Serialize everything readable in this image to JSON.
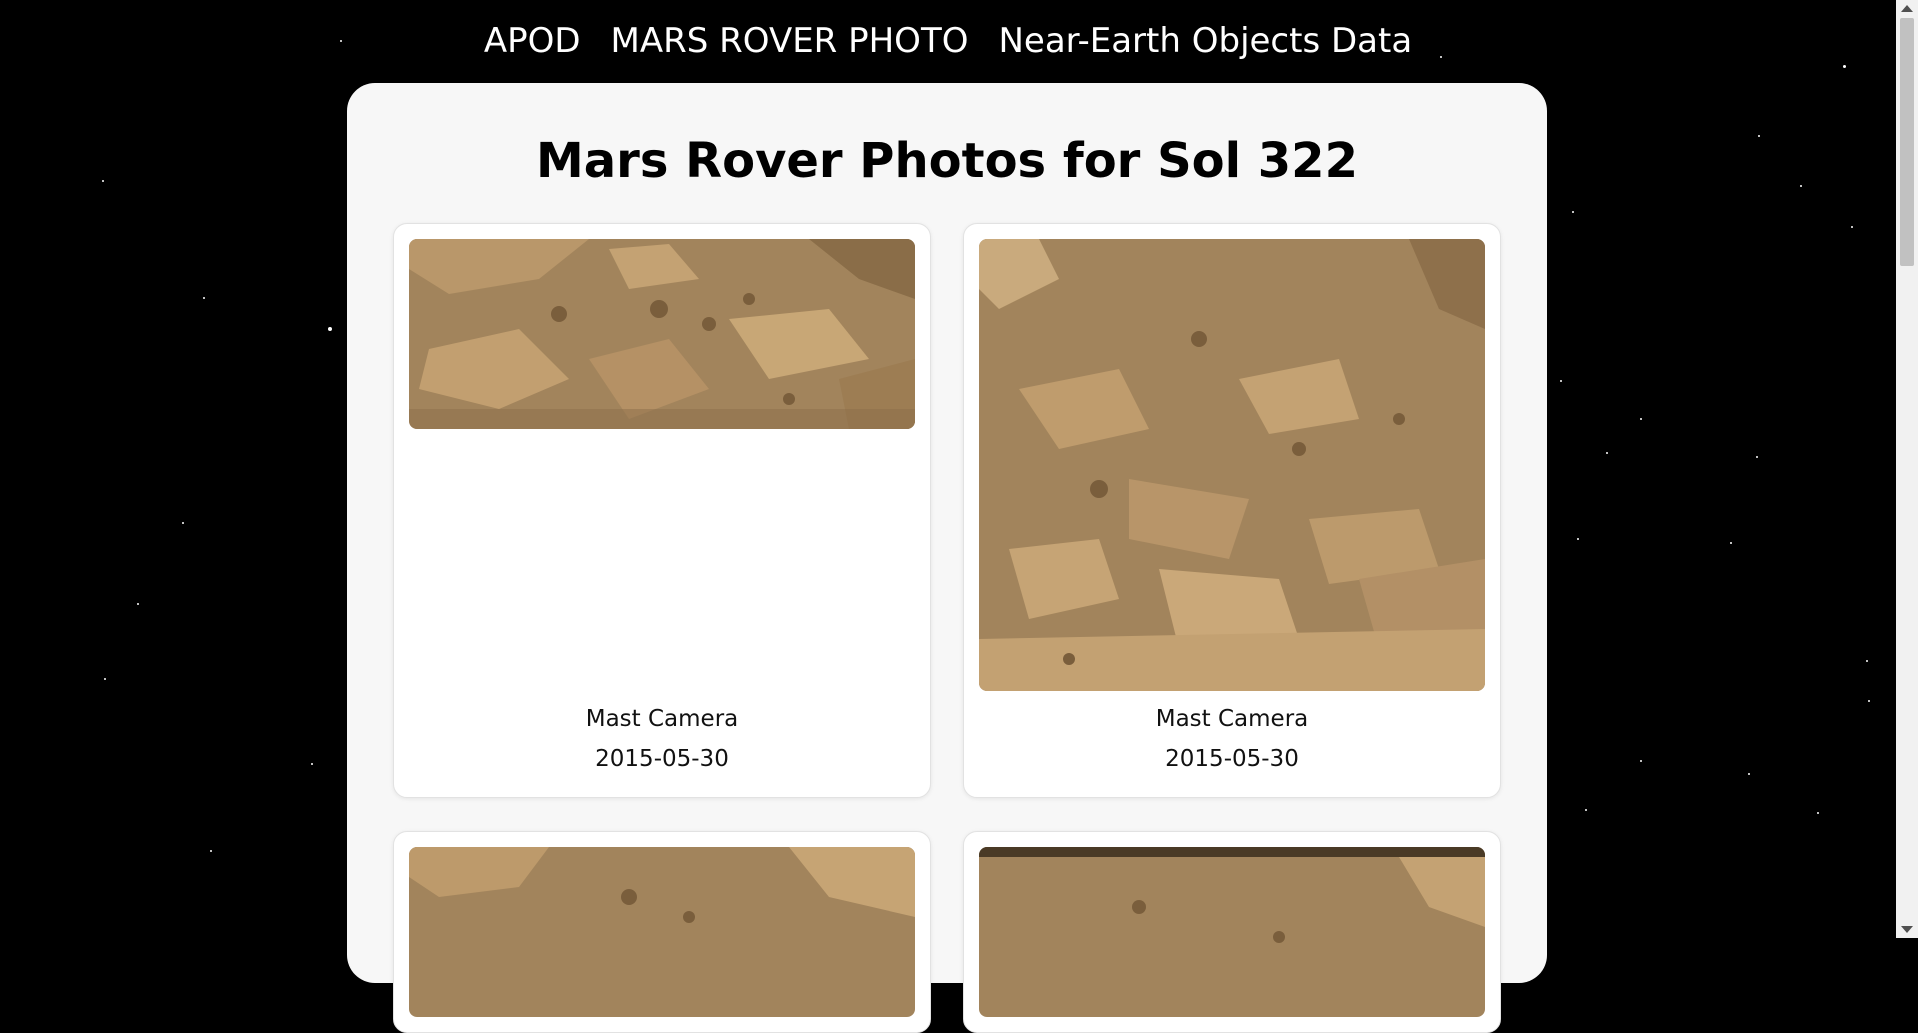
{
  "nav": {
    "items": [
      {
        "label": "APOD"
      },
      {
        "label": "MARS ROVER PHOTO"
      },
      {
        "label": "Near-Earth Objects Data"
      }
    ]
  },
  "page": {
    "title": "Mars Rover Photos for Sol 322"
  },
  "photos": [
    {
      "camera": "Mast Camera",
      "date": "2015-05-30",
      "image": "mars-terrain-photo"
    },
    {
      "camera": "Mast Camera",
      "date": "2015-05-30",
      "image": "mars-terrain-photo"
    },
    {
      "camera": "",
      "date": "",
      "image": "mars-terrain-photo"
    },
    {
      "camera": "",
      "date": "",
      "image": "mars-terrain-photo"
    }
  ],
  "colors": {
    "background": "#000000",
    "panel": "#f7f7f7",
    "card": "#ffffff",
    "terrain": "#a2845c"
  }
}
